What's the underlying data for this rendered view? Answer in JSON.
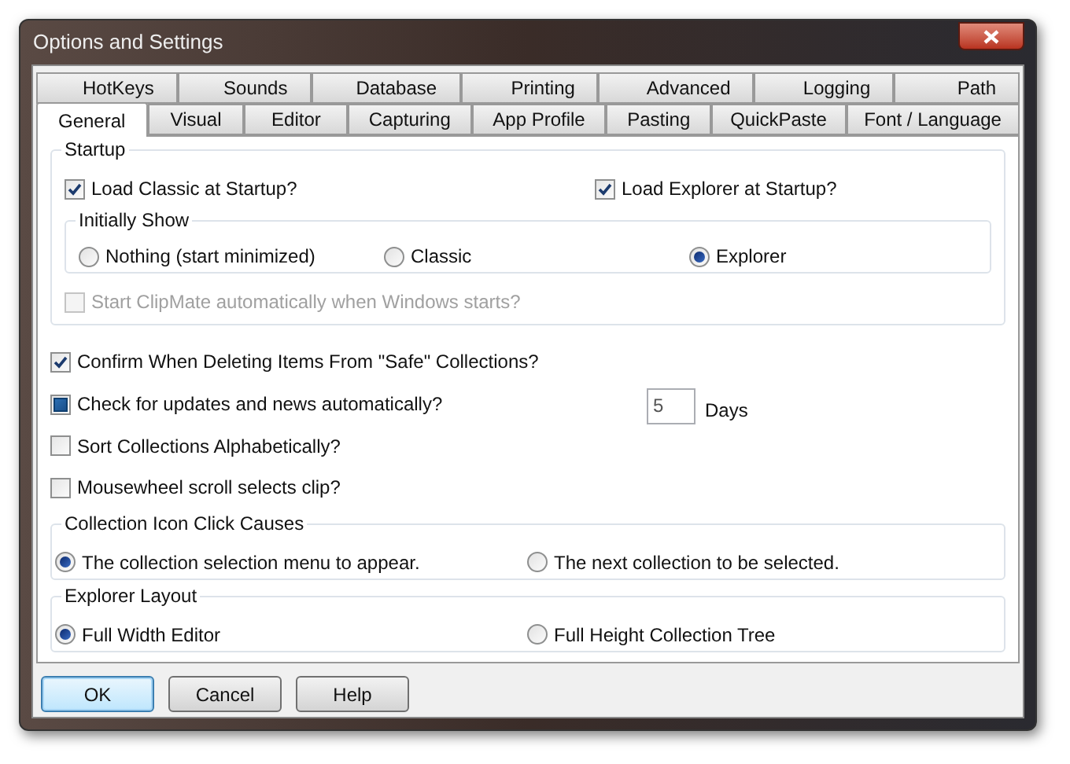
{
  "window": {
    "title": "Options and Settings"
  },
  "tabs": [
    [
      {
        "label": "HotKeys",
        "selected": false
      },
      {
        "label": "Sounds",
        "selected": false
      },
      {
        "label": "Database",
        "selected": false
      },
      {
        "label": "Printing",
        "selected": false
      },
      {
        "label": "Advanced",
        "selected": false
      },
      {
        "label": "Logging",
        "selected": false
      },
      {
        "label": "Path",
        "selected": false
      }
    ],
    [
      {
        "label": "General",
        "selected": true
      },
      {
        "label": "Visual",
        "selected": false
      },
      {
        "label": "Editor",
        "selected": false
      },
      {
        "label": "Capturing",
        "selected": false
      },
      {
        "label": "App Profile",
        "selected": false
      },
      {
        "label": "Pasting",
        "selected": false
      },
      {
        "label": "QuickPaste",
        "selected": false
      },
      {
        "label": "Font / Language",
        "selected": false
      }
    ]
  ],
  "startup": {
    "label": "Startup",
    "options": [
      {
        "label": "Load Classic at Startup?",
        "checked": true
      },
      {
        "label": "Load Explorer at Startup?",
        "checked": true
      }
    ],
    "initially_show": {
      "label": "Initially Show",
      "options": [
        {
          "label": "Nothing (start minimized)",
          "selected": false
        },
        {
          "label": "Classic",
          "selected": false
        },
        {
          "label": "Explorer",
          "selected": true
        }
      ]
    },
    "auto_start": {
      "label": "Start ClipMate automatically when Windows starts?",
      "checked": false,
      "disabled": true
    }
  },
  "options": [
    {
      "label": "Confirm When Deleting Items From \"Safe\" Collections?",
      "checked": true,
      "indeterminate": false
    },
    {
      "label": "Check for updates and news automatically?",
      "checked": false,
      "indeterminate": true,
      "interval": {
        "value": "5",
        "unit": "Days"
      }
    },
    {
      "label": "Sort Collections Alphabetically?",
      "checked": false,
      "indeterminate": false
    },
    {
      "label": "Mousewheel scroll selects clip?",
      "checked": false,
      "indeterminate": false
    }
  ],
  "groups": [
    {
      "label": "Collection Icon Click Causes",
      "options": [
        {
          "label": "The collection selection menu to appear.",
          "selected": true
        },
        {
          "label": "The next collection to be selected.",
          "selected": false
        }
      ]
    },
    {
      "label": "Explorer Layout",
      "options": [
        {
          "label": "Full Width Editor",
          "selected": true
        },
        {
          "label": "Full Height Collection Tree",
          "selected": false
        }
      ]
    }
  ],
  "buttons": [
    {
      "label": "OK",
      "default": true
    },
    {
      "label": "Cancel",
      "default": false
    },
    {
      "label": "Help",
      "default": false
    }
  ]
}
